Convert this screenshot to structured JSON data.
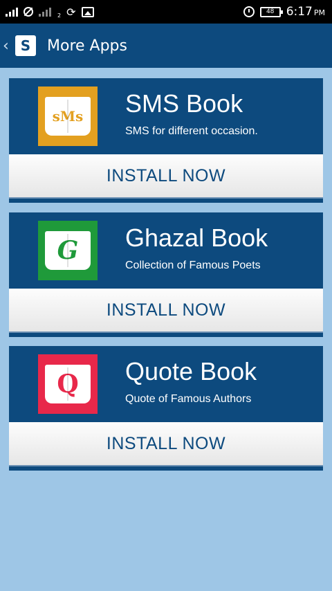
{
  "status_bar": {
    "sim2_label": "2",
    "battery": "48",
    "time": "6:17",
    "ampm": "PM"
  },
  "app_bar": {
    "title": "More Apps",
    "logo_letter": "S"
  },
  "apps": [
    {
      "title": "SMS Book",
      "subtitle": "SMS for different occasion.",
      "icon_text": "sMs",
      "icon_color": "#e3a020",
      "icon_text_color": "#e3a020",
      "install_label": "INSTALL NOW"
    },
    {
      "title": "Ghazal Book",
      "subtitle": "Collection of Famous Poets",
      "icon_text": "G",
      "icon_color": "#1f9a3a",
      "icon_text_color": "#1f9a3a",
      "install_label": "INSTALL NOW"
    },
    {
      "title": "Quote Book",
      "subtitle": "Quote of Famous Authors",
      "icon_text": "Q",
      "icon_color": "#e8284a",
      "icon_text_color": "#e8284a",
      "install_label": "INSTALL NOW"
    }
  ],
  "colors": {
    "primary": "#0d4a7e",
    "background": "#9ec6e6"
  }
}
